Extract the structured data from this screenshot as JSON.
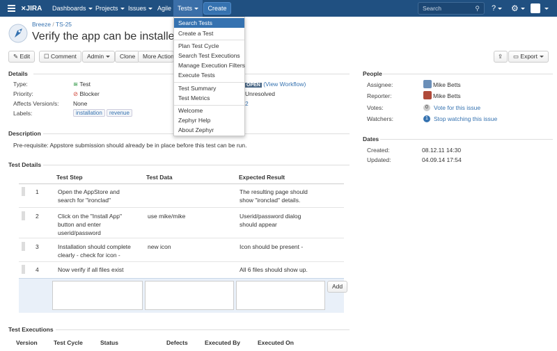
{
  "nav": {
    "logo": "JIRA",
    "dashboards": "Dashboards",
    "projects": "Projects",
    "issues": "Issues",
    "agile": "Agile",
    "tests": "Tests",
    "create": "Create",
    "search_placeholder": "Search"
  },
  "issue": {
    "project": "Breeze",
    "key": "TS-25",
    "title": "Verify the app can be installed fron"
  },
  "toolbar": {
    "edit": "Edit",
    "comment": "Comment",
    "admin": "Admin",
    "clone": "Clone",
    "more": "More Actions",
    "export": "Export"
  },
  "details": {
    "heading": "Details",
    "type_label": "Type:",
    "type_value": "Test",
    "priority_label": "Priority:",
    "priority_value": "Blocker",
    "affects_label": "Affects Version/s:",
    "affects_value": "None",
    "labels_label": "Labels:",
    "labels": [
      "installation",
      "revenue"
    ],
    "status_badge": "OPEN",
    "view_workflow": "(View Workflow)",
    "resolution": "Unresolved",
    "fix_version": "2"
  },
  "people": {
    "heading": "People",
    "assignee_label": "Assignee:",
    "assignee": "Mike Betts",
    "reporter_label": "Reporter:",
    "reporter": "Mike Betts",
    "votes_label": "Votes:",
    "votes_count": "0",
    "vote_link": "Vote for this issue",
    "watchers_label": "Watchers:",
    "watchers_count": "1",
    "watch_link": "Stop watching this issue"
  },
  "dates": {
    "heading": "Dates",
    "created_label": "Created:",
    "created": "08.12.11 14:30",
    "updated_label": "Updated:",
    "updated": "04.09.14 17:54"
  },
  "description": {
    "heading": "Description",
    "text": "Pre-requisite: Appstore submission should already be in place before this test can be run."
  },
  "test_details": {
    "heading": "Test Details",
    "columns": [
      "Test Step",
      "Test Data",
      "Expected Result"
    ],
    "rows": [
      {
        "num": "1",
        "step": "Open the AppStore and search for \"ironclad\"",
        "data": "",
        "result": "The resulting page should show \"ironclad\" details."
      },
      {
        "num": "2",
        "step": "Click on the \"Install App\" button and enter userid/password",
        "data": "use mike/mike",
        "result": "Userid/password dialog should appear"
      },
      {
        "num": "3",
        "step": "Installation should complete clearly - check for icon -",
        "data": "new icon",
        "result": "Icon should be present -"
      },
      {
        "num": "4",
        "step": "Now verify if all files exist",
        "data": "",
        "result": "All 6 files should show up."
      }
    ],
    "add": "Add"
  },
  "test_executions": {
    "heading": "Test Executions",
    "columns": [
      "Version",
      "Test Cycle",
      "Status",
      "Defects",
      "Executed By",
      "Executed On"
    ]
  },
  "dropdown": {
    "items": [
      "Search Tests",
      "Create a Test",
      "Plan Test Cycle",
      "Search Test Executions",
      "Manage Execution Filters",
      "Execute Tests",
      "Test Summary",
      "Test Metrics",
      "Welcome",
      "Zephyr Help",
      "About Zephyr"
    ]
  },
  "colors": {
    "nav_bg": "#205081",
    "accent": "#3572b0",
    "green": "#14892c"
  }
}
